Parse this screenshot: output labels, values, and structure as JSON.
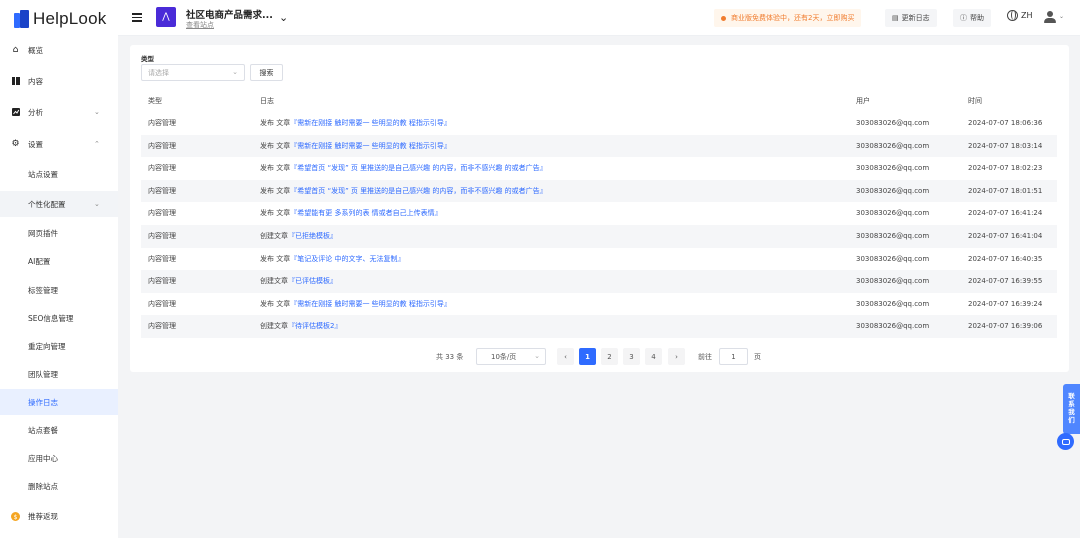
{
  "brand": {
    "logo_text": "HelpLook",
    "accent": "#2f6bff"
  },
  "sidebar": {
    "items": [
      {
        "label": "概览",
        "icon": "home-icon"
      },
      {
        "label": "内容",
        "icon": "book-icon"
      },
      {
        "label": "分析",
        "icon": "chart-icon",
        "chevron": "⌄"
      },
      {
        "label": "设置",
        "icon": "gear-icon",
        "chevron": "⌃"
      }
    ],
    "sub_items": [
      "站点设置",
      "个性化配置",
      "网页插件",
      "AI配置",
      "标签管理",
      "SEO信息管理",
      "重定向管理",
      "团队管理",
      "操作日志",
      "站点套餐",
      "应用中心",
      "删除站点"
    ],
    "sub_chevron": "⌄",
    "referral": "推荐返现"
  },
  "header": {
    "site_name": "社区电商产品需求...",
    "view_site": "查看站点",
    "promo": "商业版免费体验中，还有2天，立即购买",
    "changelog": "更新日志",
    "help": "帮助",
    "lang": "ZH"
  },
  "filter": {
    "label": "类型",
    "placeholder": "请选择",
    "search_btn": "搜索"
  },
  "table": {
    "headers": [
      "类型",
      "日志",
      "用户",
      "时间"
    ],
    "rows": [
      {
        "type": "内容管理",
        "prefix": "发布 文章",
        "link": "『需新在刚接 触时需要一 些明显的教 程指示引导』",
        "user": "303083026@qq.com",
        "time": "2024-07-07 18:06:36"
      },
      {
        "type": "内容管理",
        "prefix": "发布 文章",
        "link": "『需新在刚接 触时需要一 些明显的教 程指示引导』",
        "user": "303083026@qq.com",
        "time": "2024-07-07 18:03:14"
      },
      {
        "type": "内容管理",
        "prefix": "发布 文章",
        "link": "『希望首页 “发现” 页 里推送的是自己感兴趣 的内容，而非不感兴趣 的或者广告』",
        "user": "303083026@qq.com",
        "time": "2024-07-07 18:02:23"
      },
      {
        "type": "内容管理",
        "prefix": "发布 文章",
        "link": "『希望首页 “发现” 页 里推送的是自己感兴趣 的内容，而非不感兴趣 的或者广告』",
        "user": "303083026@qq.com",
        "time": "2024-07-07 18:01:51"
      },
      {
        "type": "内容管理",
        "prefix": "发布 文章",
        "link": "『希望能有更 多系列的表 情或者自己上传表情』",
        "user": "303083026@qq.com",
        "time": "2024-07-07 16:41:24"
      },
      {
        "type": "内容管理",
        "prefix": "创建文章",
        "link": "『已拒绝模板』",
        "user": "303083026@qq.com",
        "time": "2024-07-07 16:41:04"
      },
      {
        "type": "内容管理",
        "prefix": "发布 文章",
        "link": "『笔记及评论 中的文字、无法复制』",
        "user": "303083026@qq.com",
        "time": "2024-07-07 16:40:35"
      },
      {
        "type": "内容管理",
        "prefix": "创建文章",
        "link": "『已评估模板』",
        "user": "303083026@qq.com",
        "time": "2024-07-07 16:39:55"
      },
      {
        "type": "内容管理",
        "prefix": "发布 文章",
        "link": "『需新在刚接 触时需要一 些明显的教 程指示引导』",
        "user": "303083026@qq.com",
        "time": "2024-07-07 16:39:24"
      },
      {
        "type": "内容管理",
        "prefix": "创建文章",
        "link": "『待评估模板2』",
        "user": "303083026@qq.com",
        "time": "2024-07-07 16:39:06"
      }
    ]
  },
  "pagination": {
    "total": "共 33 条",
    "page_size": "10条/页",
    "prev": "‹",
    "next": "›",
    "pages": [
      "1",
      "2",
      "3",
      "4"
    ],
    "current": "1",
    "goto_label": "前往",
    "goto_value": "1",
    "goto_unit": "页"
  },
  "contact": "联系我们"
}
